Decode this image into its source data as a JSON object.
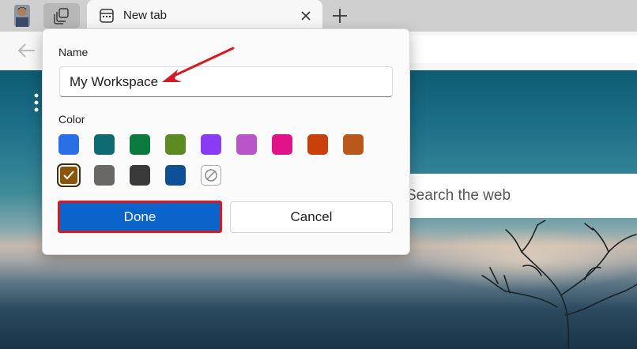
{
  "tabs": [
    {
      "title": "New tab"
    }
  ],
  "page": {
    "search_placeholder": "Search the web"
  },
  "workspace_dialog": {
    "name_label": "Name",
    "name_value": "My Workspace",
    "color_label": "Color",
    "colors": [
      {
        "hex": "#2a6ee8",
        "selected": false
      },
      {
        "hex": "#0f6b72",
        "selected": false
      },
      {
        "hex": "#0b7a3e",
        "selected": false
      },
      {
        "hex": "#5d8a22",
        "selected": false
      },
      {
        "hex": "#8a3cf2",
        "selected": false
      },
      {
        "hex": "#b755c9",
        "selected": false
      },
      {
        "hex": "#e0138a",
        "selected": false
      },
      {
        "hex": "#c9400b",
        "selected": false
      },
      {
        "hex": "#b8581c",
        "selected": false
      },
      {
        "hex": "#8a5509",
        "selected": true
      },
      {
        "hex": "#6a6866",
        "selected": false
      },
      {
        "hex": "#3a3a3a",
        "selected": false
      },
      {
        "hex": "#0f4f96",
        "selected": false
      },
      {
        "hex": "none",
        "selected": false
      }
    ],
    "done_label": "Done",
    "cancel_label": "Cancel"
  },
  "colors": {
    "accent": "#0b64c9",
    "highlight": "#d61a24"
  }
}
